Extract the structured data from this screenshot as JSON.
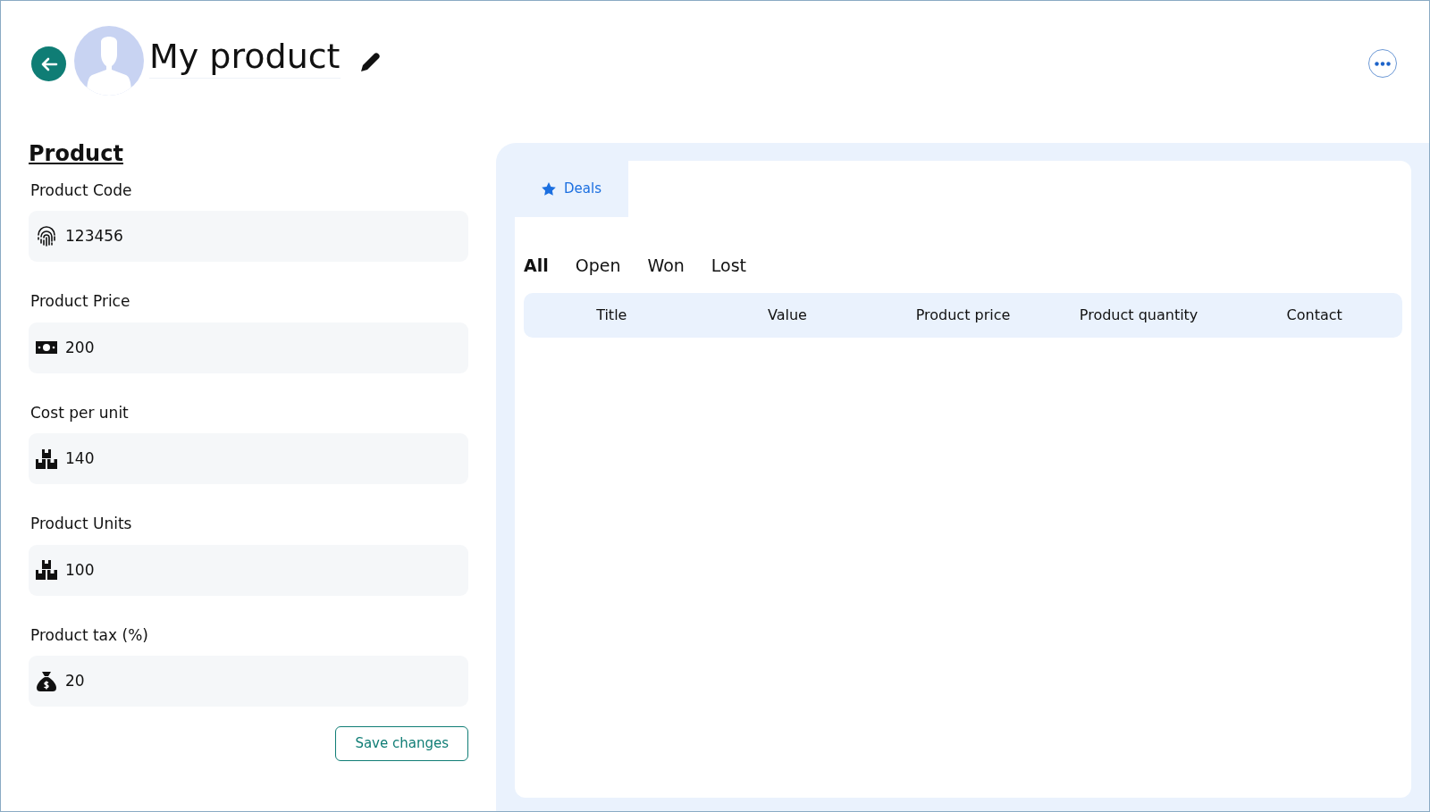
{
  "header": {
    "title": "My product"
  },
  "form": {
    "heading": "Product",
    "fields": [
      {
        "label": "Product Code",
        "value": "123456"
      },
      {
        "label": "Product Price",
        "value": "200"
      },
      {
        "label": "Cost per unit",
        "value": "140"
      },
      {
        "label": "Product Units",
        "value": "100"
      },
      {
        "label": "Product tax (%)",
        "value": "20"
      }
    ],
    "save_button": "Save changes"
  },
  "tabs": [
    {
      "label": "Deals",
      "selected": true
    }
  ],
  "filters": [
    {
      "label": "All",
      "selected": true
    },
    {
      "label": "Open",
      "selected": false
    },
    {
      "label": "Won",
      "selected": false
    },
    {
      "label": "Lost",
      "selected": false
    }
  ],
  "table": {
    "columns": [
      "Title",
      "Value",
      "Product price",
      "Product quantity",
      "Contact"
    ]
  }
}
